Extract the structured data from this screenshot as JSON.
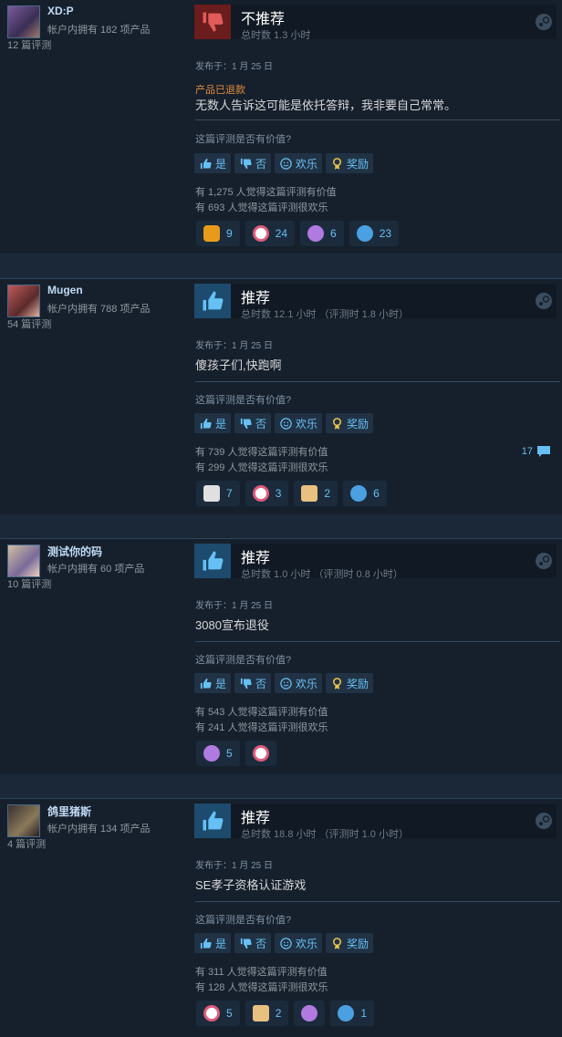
{
  "common": {
    "question": "这篇评测是否有价值?",
    "btn_yes": "是",
    "btn_no": "否",
    "btn_funny": "欢乐",
    "btn_award": "奖励"
  },
  "reviews": [
    {
      "username": "XD:P",
      "owned": "帐户内拥有 182 项产品",
      "review_count": "12 篇评测",
      "verdict": "不推荐",
      "hours": "总时数 1.3 小时",
      "posted": "发布于：1 月 25 日",
      "refunded": "产品已退款",
      "text": "无数人告诉这可能是依托答辩，我非要自己常常。",
      "helpful": "有 1,275 人觉得这篇评测有价值",
      "funny": "有 693 人觉得这篇评测很欢乐",
      "awards": [
        "9",
        "24",
        "6",
        "23"
      ]
    },
    {
      "username": "Mugen",
      "owned": "帐户内拥有 788 项产品",
      "review_count": "54 篇评测",
      "verdict": "推荐",
      "hours": "总时数 12.1 小时 （评测时 1.8 小时）",
      "posted": "发布于：1 月 25 日",
      "text": "傻孩子们,快跑啊",
      "helpful": "有 739 人觉得这篇评测有价值",
      "funny": "有 299 人觉得这篇评测很欢乐",
      "comments": "17",
      "awards": [
        "7",
        "3",
        "2",
        "6"
      ]
    },
    {
      "username": "测试你的码",
      "owned": "帐户内拥有 60 项产品",
      "review_count": "10 篇评测",
      "verdict": "推荐",
      "hours": "总时数 1.0 小时 （评测时 0.8 小时）",
      "posted": "发布于：1 月 25 日",
      "text": "3080宣布退役",
      "helpful": "有 543 人觉得这篇评测有价值",
      "funny": "有 241 人觉得这篇评测很欢乐",
      "awards": [
        "5",
        ""
      ]
    },
    {
      "username": "鸽里猪斯",
      "owned": "帐户内拥有 134 项产品",
      "review_count": "4 篇评测",
      "verdict": "推荐",
      "hours": "总时数 18.8 小时 （评测时 1.0 小时）",
      "posted": "发布于：1 月 25 日",
      "text": "SE孝子资格认证游戏",
      "helpful": "有 311 人觉得这篇评测有价值",
      "funny": "有 128 人觉得这篇评测很欢乐",
      "awards": [
        "5",
        "2",
        "",
        "1"
      ]
    }
  ]
}
